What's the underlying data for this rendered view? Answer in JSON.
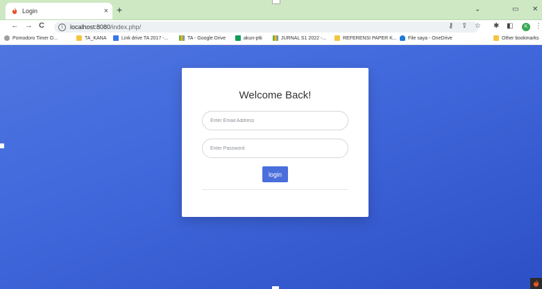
{
  "browser": {
    "tab_title": "Login",
    "tab_close": "×",
    "new_tab": "+",
    "url_host": "localhost:8080",
    "url_path": "/index.php/",
    "back": "←",
    "forward": "→",
    "reload": "C",
    "profile_initial": "K",
    "bookmarks": [
      {
        "label": "Pomodoro Timer O...",
        "color": "#9e9e9e"
      },
      {
        "label": "TA_KANA",
        "color": "#f4c542"
      },
      {
        "label": "Link drive TA 2017 -...",
        "color": "#3b78e7"
      },
      {
        "label": "TA - Google Drive",
        "color": "#34a853"
      },
      {
        "label": "akun-ptk",
        "color": "#0f9d58"
      },
      {
        "label": "JURNAL S1 2022 -...",
        "color": "#34a853"
      },
      {
        "label": "REFERENSI PAPER K...",
        "color": "#f4c542"
      },
      {
        "label": "File saya - OneDrive",
        "color": "#1e7ad8"
      }
    ],
    "other_bookmarks": "Other bookmarks"
  },
  "login": {
    "heading": "Welcome Back!",
    "email_placeholder": "Enter Email Address",
    "password_placeholder": "Enter Password",
    "submit_label": "login"
  },
  "colors": {
    "background": "#4169dc",
    "button": "#4a6fdc",
    "favicon": "#e8542a"
  }
}
